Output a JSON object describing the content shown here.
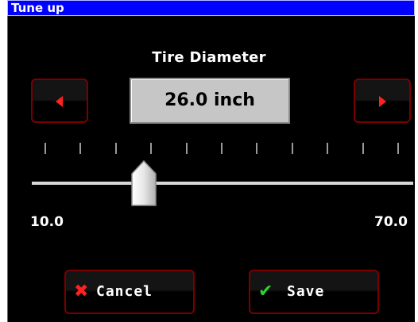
{
  "window": {
    "title": "Tune up"
  },
  "parameter": {
    "title": "Tire Diameter",
    "value_display": "26.0 inch"
  },
  "slider": {
    "min_label": "10.0",
    "max_label": "70.0",
    "min": 10.0,
    "max": 70.0,
    "value": 26.0,
    "tick_count": 11
  },
  "buttons": {
    "decrement_icon": "left-arrow-icon",
    "increment_icon": "right-arrow-icon",
    "cancel_label": "Cancel",
    "cancel_icon": "x-icon",
    "save_label": "Save",
    "save_icon": "checkmark-icon"
  },
  "colors": {
    "titlebar": "#0000ff",
    "background": "#000000",
    "button_border": "#7a0000",
    "arrow": "#ff2020",
    "cancel_icon": "#ff2020",
    "save_icon": "#30d030",
    "value_box": "#c6c6c6"
  }
}
